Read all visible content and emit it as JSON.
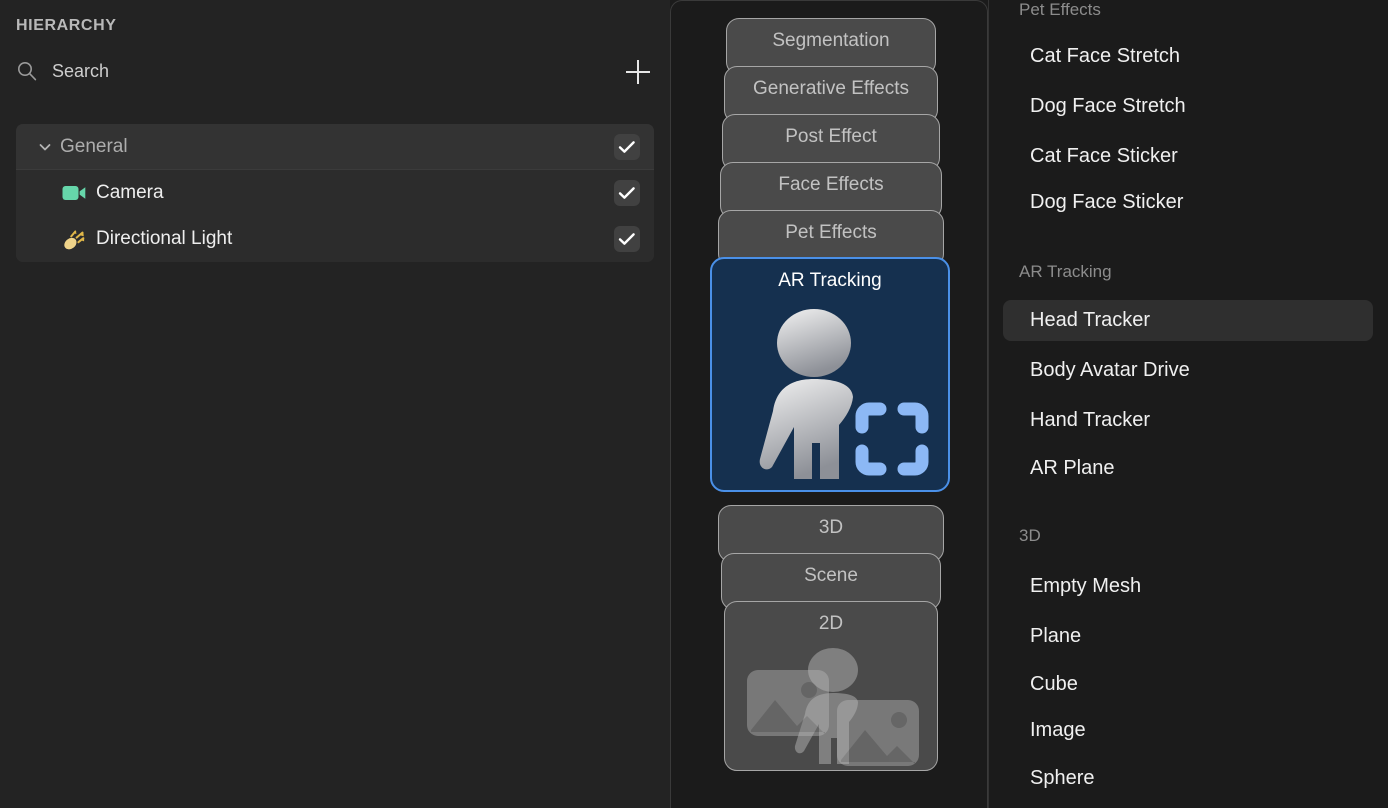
{
  "hierarchy": {
    "title": "HIERARCHY",
    "search": {
      "placeholder": "Search",
      "value": "",
      "icon": "search-icon"
    },
    "add_button": {
      "icon": "plus-icon",
      "label": "+"
    },
    "tree": [
      {
        "label": "General",
        "type": "group",
        "expanded": true,
        "checked": true,
        "icon": "chevron-down-icon"
      },
      {
        "label": "Camera",
        "type": "child",
        "checked": true,
        "icon": "camera-icon",
        "icon_color": "#66d6aa"
      },
      {
        "label": "Directional Light",
        "type": "child",
        "checked": true,
        "icon": "directional-light-icon",
        "icon_color": "#f0d48a"
      }
    ]
  },
  "stack": {
    "cards": [
      {
        "label": "Segmentation",
        "selected": false
      },
      {
        "label": "Generative Effects",
        "selected": false
      },
      {
        "label": "Post Effect",
        "selected": false
      },
      {
        "label": "Face Effects",
        "selected": false
      },
      {
        "label": "Pet Effects",
        "selected": false
      },
      {
        "label": "AR Tracking",
        "selected": true,
        "icon": "ar-tracking-person-icon"
      },
      {
        "label": "3D",
        "selected": false
      },
      {
        "label": "Scene",
        "selected": false
      },
      {
        "label": "2D",
        "selected": false,
        "icon": "images-person-icon"
      }
    ]
  },
  "list": {
    "sections": [
      {
        "header": "Pet Effects",
        "items": [
          {
            "label": "Cat Face Stretch",
            "active": false
          },
          {
            "label": "Dog Face Stretch",
            "active": false
          },
          {
            "label": "Cat Face Sticker",
            "active": false
          },
          {
            "label": "Dog Face Sticker",
            "active": false
          }
        ]
      },
      {
        "header": "AR Tracking",
        "items": [
          {
            "label": "Head Tracker",
            "active": true
          },
          {
            "label": "Body Avatar Drive",
            "active": false
          },
          {
            "label": "Hand Tracker",
            "active": false
          },
          {
            "label": "AR Plane",
            "active": false
          }
        ]
      },
      {
        "header": "3D",
        "items": [
          {
            "label": "Empty Mesh",
            "active": false
          },
          {
            "label": "Plane",
            "active": false
          },
          {
            "label": "Cube",
            "active": false
          },
          {
            "label": "Image",
            "active": false
          },
          {
            "label": "Sphere",
            "active": false
          }
        ]
      }
    ]
  },
  "colors": {
    "accent": "#4a90e8",
    "selected_card_bg": "#15304f",
    "panel_bg": "#1b1b1b",
    "hierarchy_bg": "#232323",
    "camera_icon": "#66d6aa",
    "light_icon": "#f0d48a",
    "tracker_bracket": "#8cb8f5"
  }
}
